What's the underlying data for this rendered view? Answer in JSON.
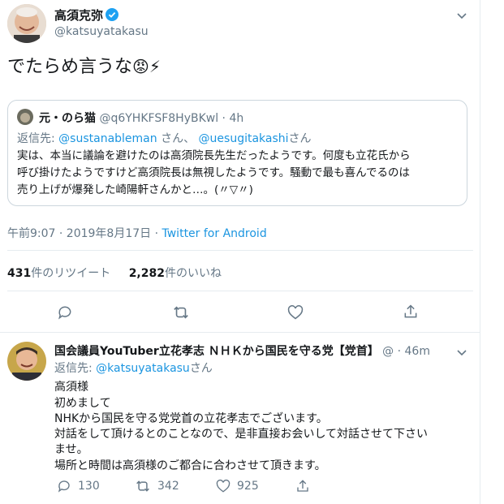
{
  "main_tweet": {
    "author_name": "高須克弥",
    "author_handle": "@katsuyatakasu",
    "text": "でたらめ言うな",
    "emoji": "😡⚡",
    "timestamp": "午前9:07 · 2019年8月17日 · ",
    "source": "Twitter for Android",
    "retweet_count": "431",
    "retweet_label": "件のリツイート",
    "like_count": "2,282",
    "like_label": "件のいいね"
  },
  "quoted_tweet": {
    "author_name": "元・のら猫",
    "author_handle": "@q6YHKFSF8HyBKwl",
    "time": " · 4h",
    "reply_prefix": "返信先: ",
    "reply_user1": "@sustanableman",
    "reply_sep": " さん、 ",
    "reply_user2": "@uesugitakashi",
    "reply_suffix": "さん",
    "lines": [
      "実は、本当に議論を避けたのは高須院長先生だったようです。何度も立花氏から",
      "呼び掛けたようですけど高須院長は無視したようです。騒動で最も喜んでるのは",
      "売り上げが爆発した崎陽軒さんかと…。(〃▽〃)"
    ]
  },
  "reply_tweet": {
    "author_name": "国会議員YouTuber立花孝志 ＮＨＫから国民を守る党【党首】",
    "handle_fragment": "@",
    "time": "· 46m",
    "reply_prefix": "返信先: ",
    "reply_user": "@katsuyatakasu",
    "reply_suffix": "さん",
    "lines": [
      "高須様",
      "初めまして",
      "NHKから国民を守る党党首の立花孝志でございます。",
      "対話をして頂けるとのことなので、是非直接お会いして対話させて下さい",
      "ませ。",
      "場所と時間は高須様のご都合に合わさせて頂きます。"
    ],
    "reply_count": "130",
    "retweet_count": "342",
    "like_count": "925"
  },
  "colors": {
    "link": "#1b95e0",
    "secondary": "#657786",
    "border": "#e6ecf0",
    "verified": "#1da1f2"
  },
  "icons": [
    "chevron-down-icon",
    "verified-badge-icon",
    "reply-icon",
    "retweet-icon",
    "like-icon",
    "share-icon"
  ]
}
